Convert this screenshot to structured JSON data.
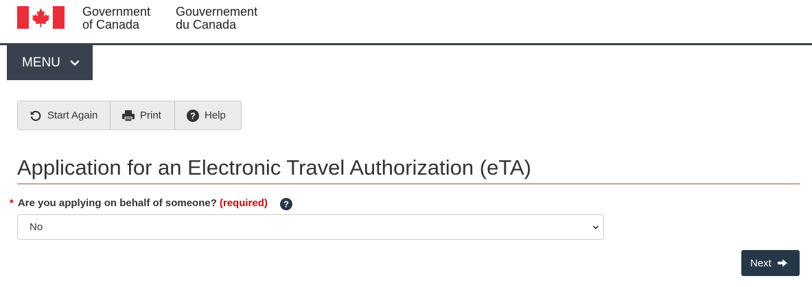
{
  "header": {
    "wordmark_en": [
      "Government",
      "of Canada"
    ],
    "wordmark_fr": [
      "Gouvernement",
      "du Canada"
    ],
    "flag_icon": "canada-flag-icon",
    "flag_color": "#eb2d37"
  },
  "menu": {
    "label": "MENU",
    "icon": "chevron-down-icon"
  },
  "toolbar": {
    "start_again": "Start Again",
    "print": "Print",
    "help": "Help",
    "icons": [
      "undo-icon",
      "printer-icon",
      "question-circle-icon"
    ]
  },
  "page": {
    "title": "Application for an Electronic Travel Authorization (eTA)",
    "accent_color": "#af3c43"
  },
  "form": {
    "question": {
      "star": "*",
      "label": "Are you applying on behalf of someone?",
      "required": "(required)",
      "help_icon": "question-circle-icon"
    },
    "behalf_select": {
      "value": "No"
    }
  },
  "actions": {
    "next": "Next",
    "next_icon": "arrow-right-icon",
    "button_color": "#26374a"
  }
}
